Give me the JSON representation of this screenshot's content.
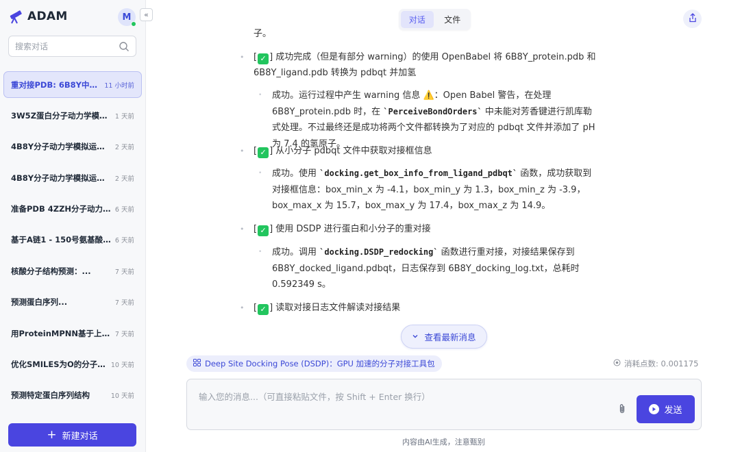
{
  "sidebar": {
    "brand": "ADAM",
    "avatar_initial": "M",
    "search_placeholder": "搜索对话",
    "conversations": [
      {
        "title": "重对接PDB: 6B8Y中蛋...",
        "time": "11 小时前",
        "active": true
      },
      {
        "title": "3W5Z蛋白分子动力学模拟...",
        "time": "1 天前"
      },
      {
        "title": "4B8Y分子动力学模拟运行...",
        "time": "2 天前"
      },
      {
        "title": "4B8Y分子动力学模拟运行...",
        "time": "2 天前"
      },
      {
        "title": "准备PDB 4ZZH分子动力学...",
        "time": "6 天前"
      },
      {
        "title": "基于A链1 - 150号氨基酸及...",
        "time": "6 天前"
      },
      {
        "title": "核酸分子结构预测：...",
        "time": "7 天前"
      },
      {
        "title": "预测蛋白序列...",
        "time": "7 天前"
      },
      {
        "title": "用ProteinMPNN基于上传...",
        "time": "7 天前"
      },
      {
        "title": "优化SMILES为O的分子结...",
        "time": "10 天前"
      },
      {
        "title": "预测特定蛋白序列结构",
        "time": "10 天前"
      }
    ],
    "new_chat_label": "新建对话"
  },
  "tabs": {
    "chat": "对话",
    "files": "文件"
  },
  "messages": {
    "cut_text": "子。",
    "item1": {
      "before": "[",
      "after": "] 成功完成（但是有部分 warning）的使用 OpenBabel 将 6B8Y_protein.pdb 和 6B8Y_ligand.pdb 转换为 pdbqt 并加氢",
      "sub_a": "成功。运行过程中产生 warning 信息 ",
      "sub_b": "：Open Babel 警告，在处理 6B8Y_protein.pdb 时，在 ",
      "sub_code": "`PerceiveBondOrders`",
      "sub_c": " 中未能对芳香键进行凯库勒式处理。不过最终还是成功将两个文件都转换为了对应的 pdbqt 文件并添加了 pH 为 7.4 的氢原子。"
    },
    "item2": {
      "after": "] 从小分子 pdbqt 文件中获取对接框信息",
      "sub_a": "成功。使用 ",
      "sub_code": "`docking.get_box_info_from_ligand_pdbqt`",
      "sub_b": " 函数，成功获取到对接框信息：box_min_x 为 -4.1，box_min_y 为 1.3，box_min_z 为 -3.9，box_max_x 为 15.7，box_max_y 为 17.4，box_max_z 为 14.9。"
    },
    "item3": {
      "after": "] 使用 DSDP 进行蛋白和小分子的重对接",
      "sub_a": "成功。调用 ",
      "sub_code": "`docking.DSDP_redocking`",
      "sub_b": " 函数进行重对接，对接结果保存到 6B8Y_docked_ligand.pdbqt，日志保存到 6B8Y_docking_log.txt，总耗时 0.592349 s。"
    },
    "item4": {
      "after": "] 读取对接日志文件解读对接结果"
    },
    "check_mark": "✓",
    "warn_mark": "⚠️"
  },
  "latest_button": "查看最新消息",
  "tool_tag": "Deep Site Docking Pose (DSDP)：GPU 加速的分子对接工具包",
  "cost": "消耗点数: 0.001175",
  "input": {
    "placeholder": "输入您的消息...（可直接粘贴文件，按 Shift + Enter 换行）",
    "send_label": "发送"
  },
  "footer_note": "内容由AI生成，注意甄别",
  "colors": {
    "accent": "#4a45e0",
    "check": "#22c55e",
    "active_bg": "#e3e6fb"
  }
}
